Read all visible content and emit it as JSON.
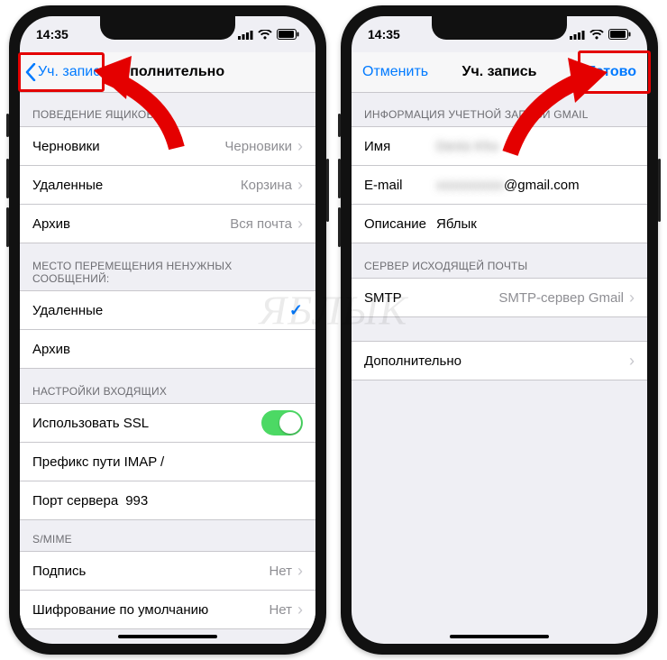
{
  "time": "14:35",
  "watermark": "ЯБЛЫК",
  "left": {
    "back_label": "Уч. запись",
    "title": "Дополнительно",
    "sections": {
      "behavior_header": "ПОВЕДЕНИЕ ЯЩИКОВ",
      "behavior": [
        {
          "label": "Черновики",
          "value": "Черновики"
        },
        {
          "label": "Удаленные",
          "value": "Корзина"
        },
        {
          "label": "Архив",
          "value": "Вся почта"
        }
      ],
      "move_header": "МЕСТО ПЕРЕМЕЩЕНИЯ НЕНУЖНЫХ СООБЩЕНИЙ:",
      "move": [
        {
          "label": "Удаленные",
          "checked": true
        },
        {
          "label": "Архив",
          "checked": false
        }
      ],
      "incoming_header": "НАСТРОЙКИ ВХОДЯЩИХ",
      "incoming": {
        "ssl_label": "Использовать SSL",
        "ssl_on": true,
        "imap_prefix_label": "Префикс пути IMAP",
        "imap_prefix_value": "/",
        "port_label": "Порт сервера",
        "port_value": "993"
      },
      "smime_header": "S/MIME",
      "smime": [
        {
          "label": "Подпись",
          "value": "Нет"
        },
        {
          "label": "Шифрование по умолчанию",
          "value": "Нет"
        }
      ]
    }
  },
  "right": {
    "cancel_label": "Отменить",
    "title": "Уч. запись",
    "done_label": "Готово",
    "info_header": "ИНФОРМАЦИЯ УЧЕТНОЙ ЗАПИСИ GMAIL",
    "fields": {
      "name_label": "Имя",
      "name_value": "Denis Kho",
      "email_label": "E-mail",
      "email_value_hidden": "xxxxxxxxxx",
      "email_domain": "@gmail.com",
      "desc_label": "Описание",
      "desc_value": "Яблык"
    },
    "smtp_header": "СЕРВЕР ИСХОДЯЩЕЙ ПОЧТЫ",
    "smtp_label": "SMTP",
    "smtp_value": "SMTP-сервер Gmail",
    "advanced_label": "Дополнительно"
  }
}
